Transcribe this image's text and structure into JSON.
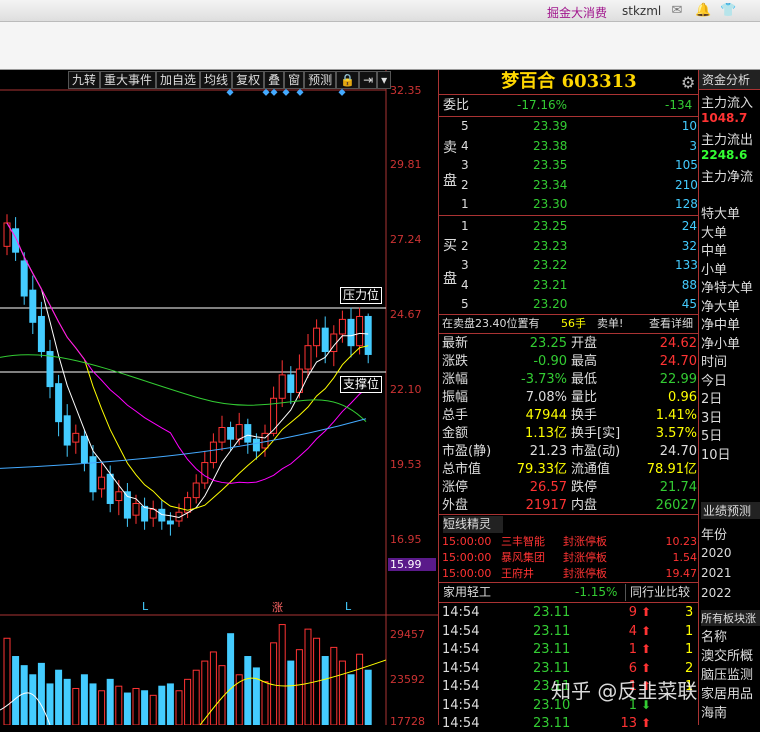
{
  "topbar": {
    "link": "掘金大消费",
    "user": "stkzml",
    "icons": [
      "mail-icon",
      "bell-icon",
      "shirt-icon"
    ]
  },
  "toolbar": [
    "九转",
    "重大事件",
    "加自选",
    "均线",
    "复权",
    "叠",
    "窗",
    "预测",
    "🔒",
    "⇥",
    "▾"
  ],
  "price_axis": [
    "32.35",
    "29.81",
    "27.24",
    "24.67",
    "22.10",
    "19.53",
    "16.95",
    "15.99"
  ],
  "volume_axis": [
    "29457",
    "23592",
    "17728"
  ],
  "chart_labels": {
    "pressure": "压力位",
    "support": "支撑位",
    "markers": [
      "L",
      "涨",
      "L"
    ]
  },
  "stock": {
    "name": "梦百合",
    "code": "603313"
  },
  "weibi": {
    "label": "委比",
    "pct": "-17.16%",
    "diff": "-134"
  },
  "sell_label": [
    "卖",
    "盘"
  ],
  "buy_label": [
    "买",
    "盘"
  ],
  "sells": [
    {
      "lvl": "5",
      "price": "23.39",
      "vol": "10"
    },
    {
      "lvl": "4",
      "price": "23.38",
      "vol": "3"
    },
    {
      "lvl": "3",
      "price": "23.35",
      "vol": "105"
    },
    {
      "lvl": "2",
      "price": "23.34",
      "vol": "210"
    },
    {
      "lvl": "1",
      "price": "23.30",
      "vol": "128"
    }
  ],
  "buys": [
    {
      "lvl": "1",
      "price": "23.25",
      "vol": "24"
    },
    {
      "lvl": "2",
      "price": "23.23",
      "vol": "32"
    },
    {
      "lvl": "3",
      "price": "23.22",
      "vol": "133"
    },
    {
      "lvl": "4",
      "price": "23.21",
      "vol": "88"
    },
    {
      "lvl": "5",
      "price": "23.20",
      "vol": "45"
    }
  ],
  "notice": {
    "text": "在卖盘23.40位置有",
    "qty": "56手",
    "act": "卖单!",
    "detail": "查看详细"
  },
  "quote_left": [
    {
      "k": "最新",
      "v": "23.25",
      "cls": "g"
    },
    {
      "k": "涨跌",
      "v": "-0.90",
      "cls": "g"
    },
    {
      "k": "涨幅",
      "v": "-3.73%",
      "cls": "g"
    },
    {
      "k": "振幅",
      "v": "7.08%",
      "cls": "w"
    },
    {
      "k": "总手",
      "v": "47944",
      "cls": "y"
    },
    {
      "k": "金额",
      "v": "1.13亿",
      "cls": "y"
    },
    {
      "k": "市盈(静)",
      "v": "21.23",
      "cls": "w"
    },
    {
      "k": "总市值",
      "v": "79.33亿",
      "cls": "y"
    },
    {
      "k": "涨停",
      "v": "26.57",
      "cls": "r"
    },
    {
      "k": "外盘",
      "v": "21917",
      "cls": "r"
    }
  ],
  "quote_right": [
    {
      "k": "开盘",
      "v": "24.62",
      "cls": "r"
    },
    {
      "k": "最高",
      "v": "24.70",
      "cls": "r"
    },
    {
      "k": "最低",
      "v": "22.99",
      "cls": "g"
    },
    {
      "k": "量比",
      "v": "0.96",
      "cls": "y"
    },
    {
      "k": "换手",
      "v": "1.41%",
      "cls": "y"
    },
    {
      "k": "换手[实]",
      "v": "3.57%",
      "cls": "y"
    },
    {
      "k": "市盈(动)",
      "v": "24.70",
      "cls": "w"
    },
    {
      "k": "流通值",
      "v": "78.91亿",
      "cls": "y"
    },
    {
      "k": "跌停",
      "v": "21.74",
      "cls": "g"
    },
    {
      "k": "内盘",
      "v": "26027",
      "cls": "g"
    }
  ],
  "elves": {
    "title": "短线精灵",
    "items": [
      {
        "time": "15:00:00",
        "name": "三丰智能",
        "evt": "封涨停板",
        "val": "10.23"
      },
      {
        "time": "15:00:00",
        "name": "暴风集团",
        "evt": "封涨停板",
        "val": "1.54"
      },
      {
        "time": "15:00:00",
        "name": "王府井",
        "evt": "封涨停板",
        "val": "19.47"
      }
    ]
  },
  "industry": {
    "name": "家用轻工",
    "pct": "-1.15%",
    "compare": "同行业比较"
  },
  "ticks": [
    {
      "t": "14:54",
      "p": "23.11",
      "v": "9",
      "dir": "up",
      "x": "3"
    },
    {
      "t": "14:54",
      "p": "23.11",
      "v": "4",
      "dir": "up",
      "x": "1"
    },
    {
      "t": "14:54",
      "p": "23.11",
      "v": "1",
      "dir": "up",
      "x": "1"
    },
    {
      "t": "14:54",
      "p": "23.11",
      "v": "6",
      "dir": "up",
      "x": "2"
    },
    {
      "t": "14:54",
      "p": "23.11",
      "v": "1",
      "dir": "up",
      "x": "1"
    },
    {
      "t": "14:54",
      "p": "23.10",
      "v": "1",
      "dir": "dn",
      "x": ""
    },
    {
      "t": "14:54",
      "p": "23.11",
      "v": "13",
      "dir": "up",
      "x": ""
    }
  ],
  "far": {
    "header": "资金分析",
    "items": [
      "主力流入",
      "1048.7",
      "主力流出",
      "2248.6",
      "主力净流",
      "",
      "特大单",
      "大单",
      "中单",
      "小单",
      "净特大单",
      "净大单",
      "净中单",
      "净小单",
      "时间",
      "今日",
      "2日",
      "3日",
      "5日",
      "10日"
    ],
    "forecast": "业绩预测",
    "year_label": "年份",
    "years": [
      "2020",
      "2021",
      "2022"
    ],
    "blocks": "所有板块涨",
    "block_items": [
      "名称",
      "澳交所概",
      "脑压监测",
      "家居用品",
      "海南"
    ]
  },
  "watermark": "知乎 @反韭菜联盟"
}
